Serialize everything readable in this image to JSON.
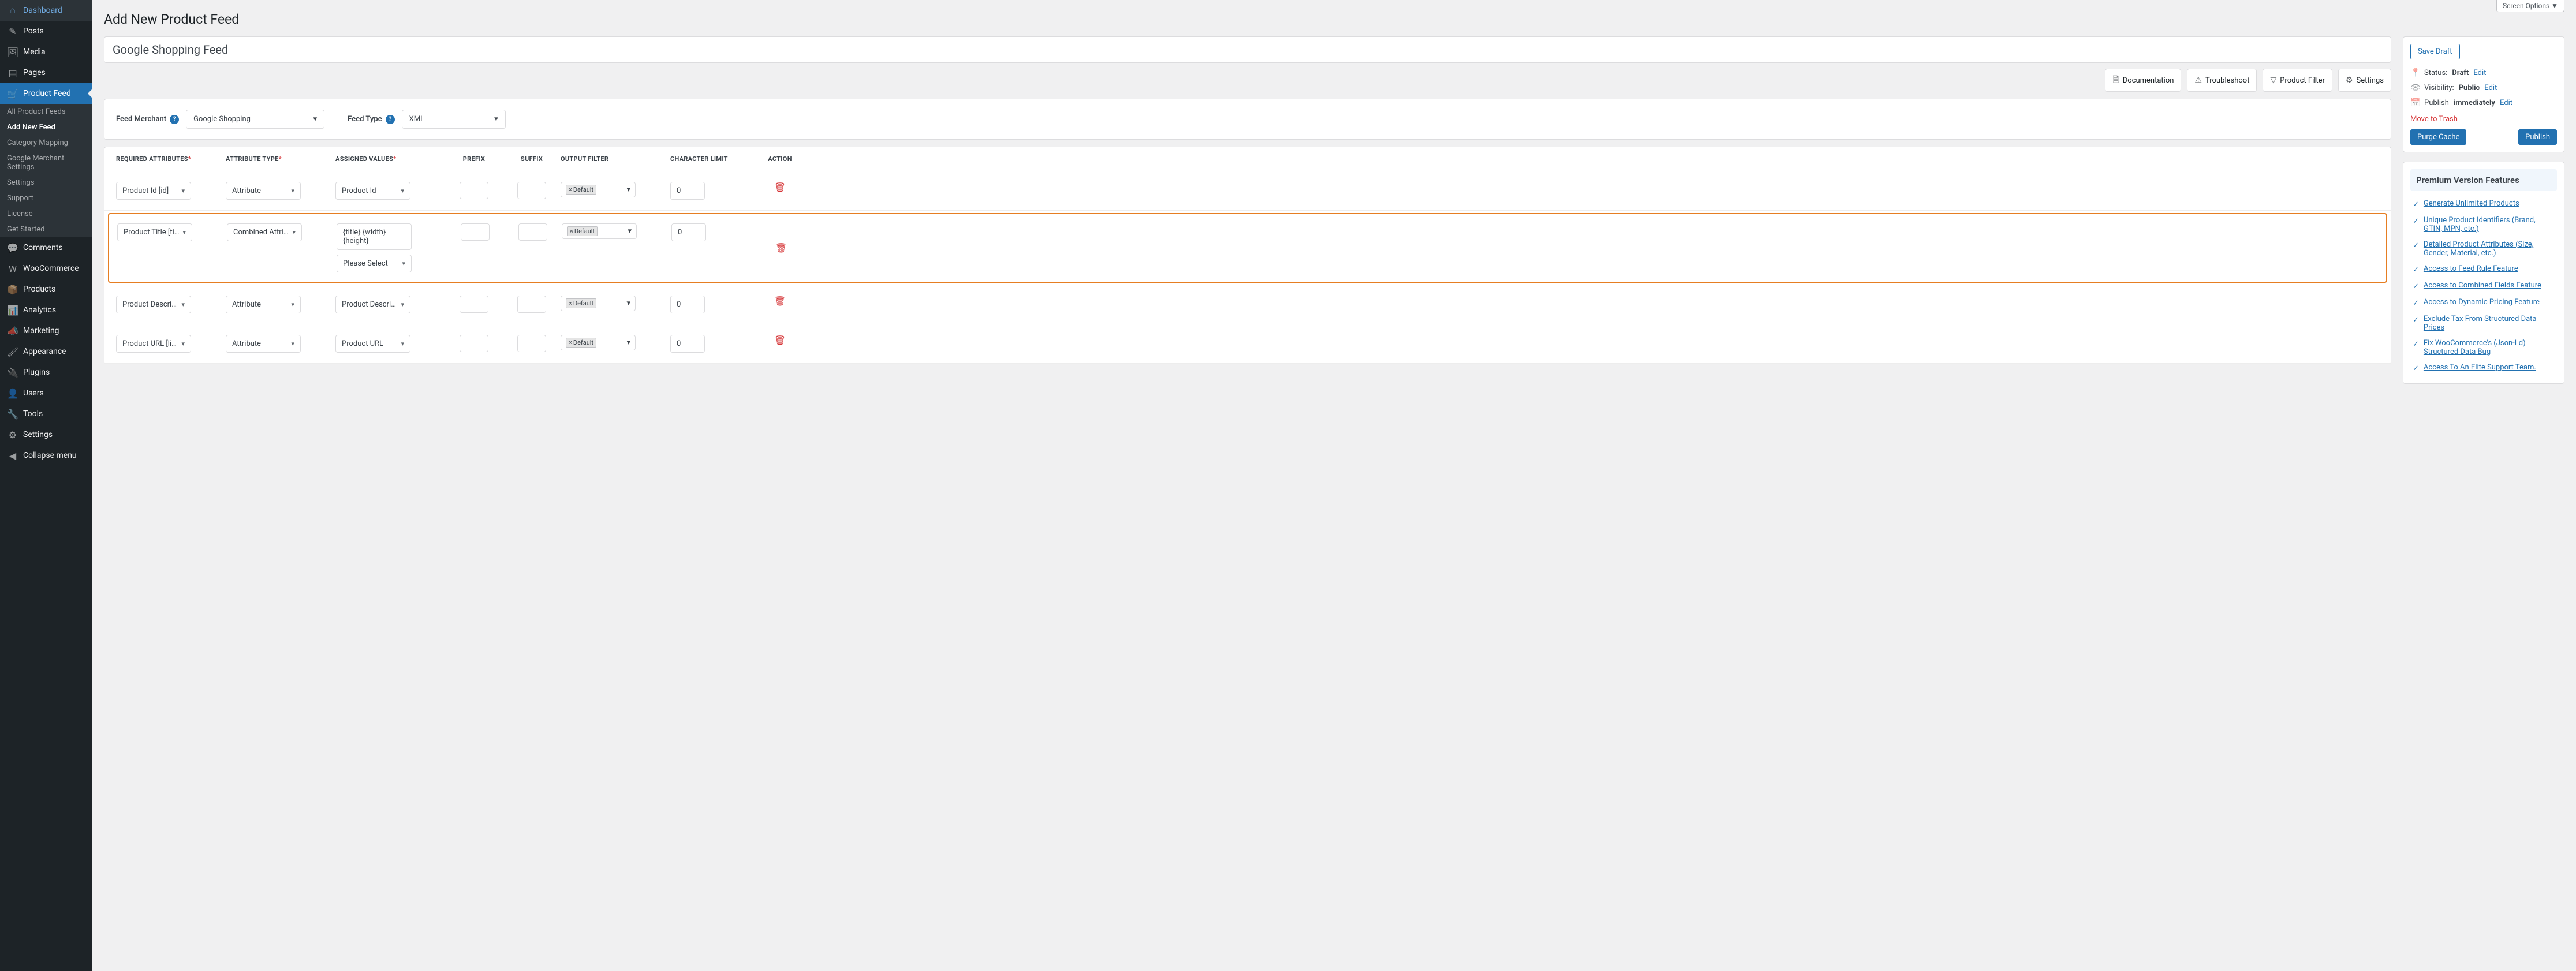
{
  "screen_options": "Screen Options ▼",
  "page_title": "Add New Product Feed",
  "feed_title": "Google Shopping Feed",
  "sidebar": {
    "items": [
      {
        "label": "Dashboard",
        "icon": "⌂"
      },
      {
        "label": "Posts",
        "icon": "✎"
      },
      {
        "label": "Media",
        "icon": "🖼"
      },
      {
        "label": "Pages",
        "icon": "▤"
      },
      {
        "label": "Product Feed",
        "icon": "🛒"
      },
      {
        "label": "Comments",
        "icon": "💬"
      },
      {
        "label": "WooCommerce",
        "icon": "W"
      },
      {
        "label": "Products",
        "icon": "📦"
      },
      {
        "label": "Analytics",
        "icon": "📊"
      },
      {
        "label": "Marketing",
        "icon": "📣"
      },
      {
        "label": "Appearance",
        "icon": "🖌"
      },
      {
        "label": "Plugins",
        "icon": "🔌"
      },
      {
        "label": "Users",
        "icon": "👤"
      },
      {
        "label": "Tools",
        "icon": "🔧"
      },
      {
        "label": "Settings",
        "icon": "⚙"
      },
      {
        "label": "Collapse menu",
        "icon": "◀"
      }
    ],
    "submenu": [
      "All Product Feeds",
      "Add New Feed",
      "Category Mapping",
      "Google Merchant Settings",
      "Settings",
      "Support",
      "License",
      "Get Started"
    ]
  },
  "toolbar": {
    "documentation": "Documentation",
    "troubleshoot": "Troubleshoot",
    "product_filter": "Product Filter",
    "settings": "Settings"
  },
  "merchant": {
    "label": "Feed Merchant",
    "value": "Google Shopping",
    "type_label": "Feed Type",
    "type_value": "XML"
  },
  "table": {
    "headers": {
      "required": "Required Attributes",
      "type": "Attribute Type",
      "assigned": "Assigned Values",
      "prefix": "Prefix",
      "suffix": "Suffix",
      "output": "Output Filter",
      "char": "Character Limit",
      "action": "Action"
    },
    "rows": [
      {
        "req": "Product Id [id]",
        "type": "Attribute",
        "assigned": "Product Id",
        "output": "Default",
        "char": "0"
      },
      {
        "req": "Product Title [title]",
        "type": "Combined Attributes",
        "assigned_text": "{title} {width} {height}",
        "assigned_select": "Please Select",
        "output": "Default",
        "char": "0"
      },
      {
        "req": "Product Description [description]",
        "type": "Attribute",
        "assigned": "Product Description",
        "output": "Default",
        "char": "0"
      },
      {
        "req": "Product URL [link]",
        "type": "Attribute",
        "assigned": "Product URL",
        "output": "Default",
        "char": "0"
      }
    ]
  },
  "publish": {
    "save_draft": "Save Draft",
    "status_label": "Status:",
    "status_value": "Draft",
    "visibility_label": "Visibility:",
    "visibility_value": "Public",
    "publish_label": "Publish",
    "publish_value": "immediately",
    "edit": "Edit",
    "trash": "Move to Trash",
    "purge": "Purge Cache",
    "publish_btn": "Publish"
  },
  "premium": {
    "title": "Premium Version Features",
    "features": [
      "Generate Unlimited Products",
      "Unique Product Identifiers (Brand, GTIN, MPN, etc.)",
      "Detailed Product Attributes (Size, Gender, Material, etc.)",
      "Access to Feed Rule Feature",
      "Access to Combined Fields Feature",
      "Access to Dynamic Pricing Feature",
      "Exclude Tax From Structured Data Prices",
      "Fix WooCommerce's (Json-Ld) Structured Data Bug",
      "Access To An Elite Support Team."
    ]
  }
}
